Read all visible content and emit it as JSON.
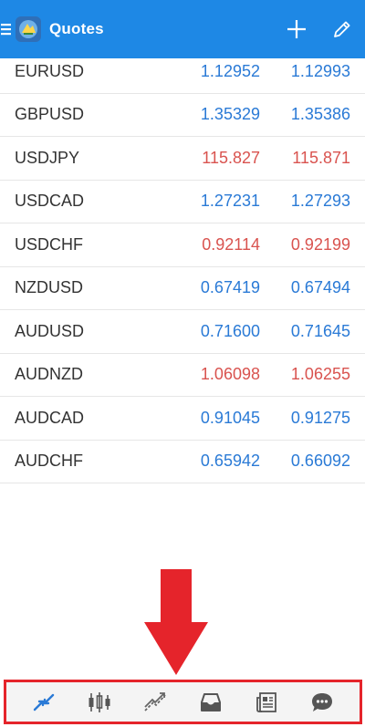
{
  "header": {
    "title": "Quotes",
    "color": "#1e88e5"
  },
  "quotes": [
    {
      "symbol": "EURUSD",
      "bid": "1.12952",
      "ask": "1.12993",
      "trend": "up"
    },
    {
      "symbol": "GBPUSD",
      "bid": "1.35329",
      "ask": "1.35386",
      "trend": "up"
    },
    {
      "symbol": "USDJPY",
      "bid": "115.827",
      "ask": "115.871",
      "trend": "down"
    },
    {
      "symbol": "USDCAD",
      "bid": "1.27231",
      "ask": "1.27293",
      "trend": "up"
    },
    {
      "symbol": "USDCHF",
      "bid": "0.92114",
      "ask": "0.92199",
      "trend": "down"
    },
    {
      "symbol": "NZDUSD",
      "bid": "0.67419",
      "ask": "0.67494",
      "trend": "up"
    },
    {
      "symbol": "AUDUSD",
      "bid": "0.71600",
      "ask": "0.71645",
      "trend": "up"
    },
    {
      "symbol": "AUDNZD",
      "bid": "1.06098",
      "ask": "1.06255",
      "trend": "down"
    },
    {
      "symbol": "AUDCAD",
      "bid": "0.91045",
      "ask": "0.91275",
      "trend": "up"
    },
    {
      "symbol": "AUDCHF",
      "bid": "0.65942",
      "ask": "0.66092",
      "trend": "up"
    }
  ],
  "colors": {
    "up": "#2a7ad6",
    "down": "#d9534f",
    "highlight": "#e5242b"
  },
  "bottom_nav": [
    {
      "icon": "quotes-icon",
      "active": true
    },
    {
      "icon": "chart-icon",
      "active": false
    },
    {
      "icon": "trade-icon",
      "active": false
    },
    {
      "icon": "history-icon",
      "active": false
    },
    {
      "icon": "news-icon",
      "active": false
    },
    {
      "icon": "messages-icon",
      "active": false
    }
  ]
}
